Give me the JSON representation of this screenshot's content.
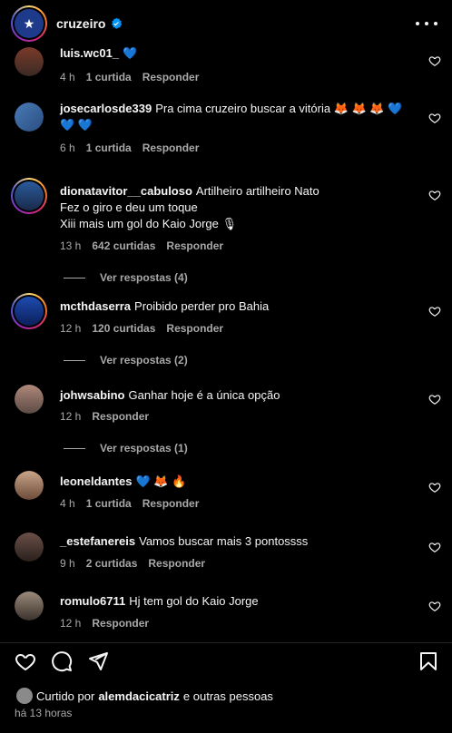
{
  "header": {
    "username": "cruzeiro"
  },
  "comments": [
    {
      "user": "luis.wc01_",
      "text": "💙",
      "time": "4 h",
      "likes": "1 curtida",
      "reply": "Responder"
    },
    {
      "user": "josecarlosde339",
      "text": "Pra cima cruzeiro buscar a vitória 🦊 🦊 🦊 💙 💙 💙",
      "time": "6 h",
      "likes": "1 curtida",
      "reply": "Responder"
    },
    {
      "user": "dionatavitor__cabuloso",
      "text": "Artilheiro artilheiro Nato",
      "text2": "Fez o giro e deu um toque",
      "text3": "Xiii mais um gol do Kaio Jorge 🎙",
      "time": "13 h",
      "likes": "642 curtidas",
      "reply": "Responder",
      "replies": "Ver respostas (4)"
    },
    {
      "user": "mcthdaserra",
      "text": "Proibido perder pro Bahia",
      "time": "12 h",
      "likes": "120 curtidas",
      "reply": "Responder",
      "replies": "Ver respostas (2)"
    },
    {
      "user": "johwsabino",
      "text": "Ganhar hoje é a única opção",
      "time": "12 h",
      "likes": "",
      "reply": "Responder",
      "replies": "Ver respostas (1)"
    },
    {
      "user": "leoneldantes",
      "text": "💙 🦊 🔥",
      "time": "4 h",
      "likes": "1 curtida",
      "reply": "Responder"
    },
    {
      "user": "_estefanereis",
      "text": "Vamos buscar mais 3 pontossss",
      "time": "9 h",
      "likes": "2 curtidas",
      "reply": "Responder"
    },
    {
      "user": "romulo6711",
      "text": "Hj tem gol do Kaio Jorge",
      "time": "12 h",
      "likes": "",
      "reply": "Responder"
    }
  ],
  "footer": {
    "liked_prefix": "Curtido por",
    "liked_user": "alemdacicatriz",
    "liked_suffix": "e outras pessoas",
    "time": "há 13 horas"
  },
  "colors": {
    "background": "#000000",
    "text": "#f5f5f5",
    "muted": "#a8a8a8",
    "verified": "#0095f6"
  }
}
